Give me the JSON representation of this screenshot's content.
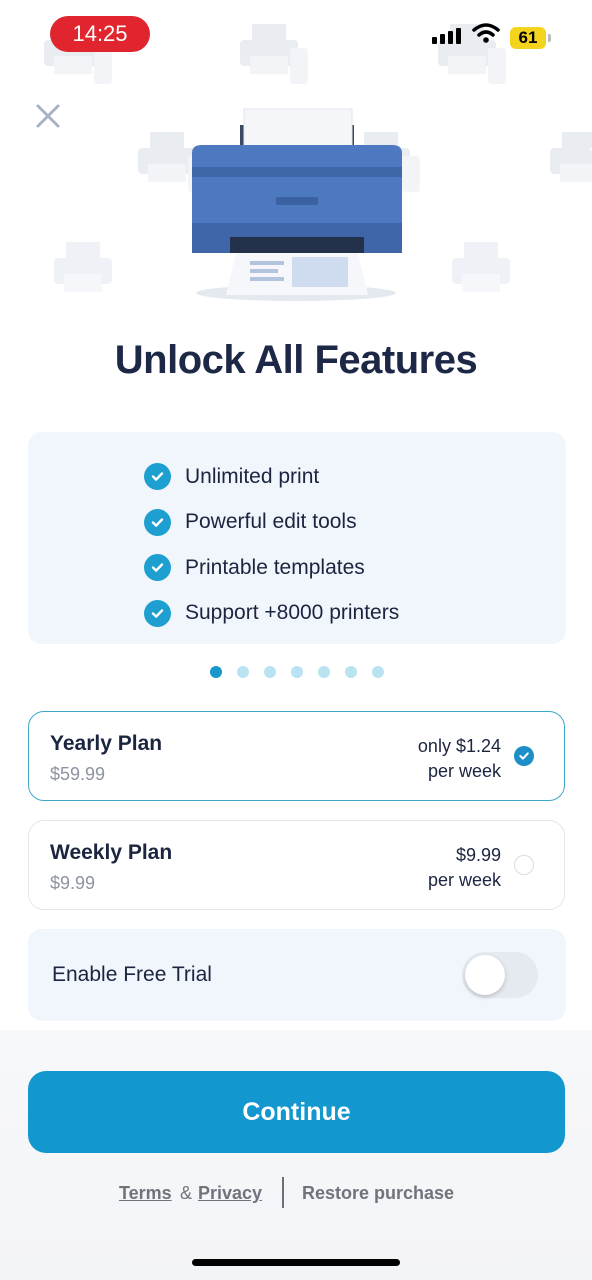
{
  "status_bar": {
    "time": "14:25",
    "battery": "61"
  },
  "paywall": {
    "title": "Unlock All Features",
    "features": [
      "Unlimited print",
      "Powerful edit tools",
      "Printable templates",
      "Support +8000 printers"
    ],
    "pagination": {
      "count": 7,
      "active_index": 0
    },
    "plans": [
      {
        "name": "Yearly Plan",
        "price": "$59.99",
        "rate_line1": "only $1.24",
        "rate_line2": "per week",
        "selected": true
      },
      {
        "name": "Weekly Plan",
        "price": "$9.99",
        "rate_line1": "$9.99",
        "rate_line2": "per week",
        "selected": false
      }
    ],
    "trial": {
      "label": "Enable Free Trial",
      "enabled": false
    },
    "continue_label": "Continue"
  },
  "footer": {
    "terms": "Terms",
    "amp": "&",
    "privacy": "Privacy",
    "restore": "Restore purchase"
  },
  "colors": {
    "accent": "#1298cf",
    "check": "#1d9fd0",
    "title": "#1d2746",
    "panel_bg": "#f1f5fc",
    "time_pill": "#e0252f",
    "battery": "#f4d31d"
  }
}
